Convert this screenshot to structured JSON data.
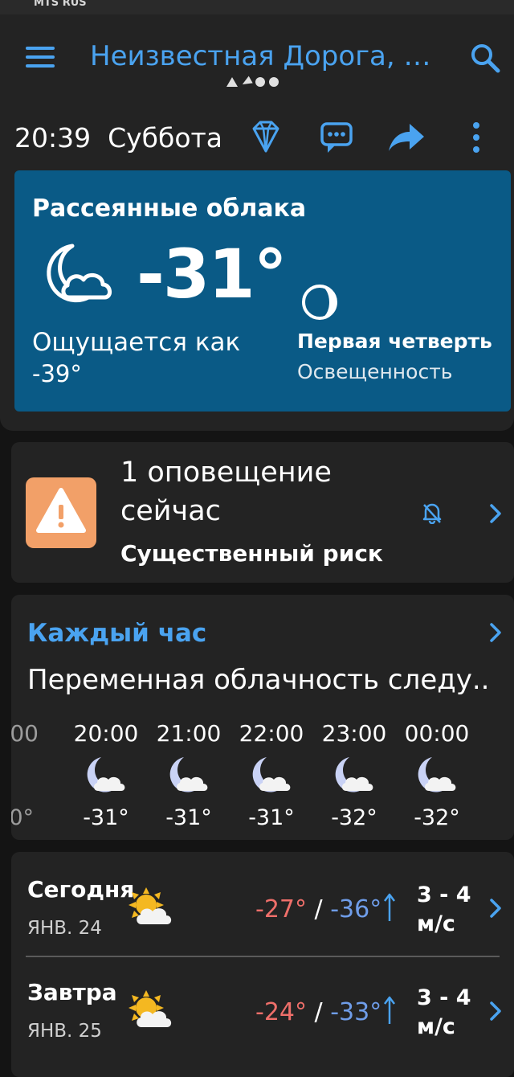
{
  "status_bar": {
    "carrier": "MTS RUS"
  },
  "app_bar": {
    "location_title": "Неизвестная Дорога, Т..."
  },
  "toolbar": {
    "time": "20:39",
    "day": "Суббота"
  },
  "current": {
    "condition": "Рассеянные облака",
    "temperature": "-31°",
    "feels_like_label": "Ощущается как",
    "feels_like_value": "-39°",
    "moon_phase": "Первая четверть",
    "moon_subtitle": "Освещенность"
  },
  "alert": {
    "line1": "1 оповещение",
    "line2": "сейчас",
    "risk": "Существенный риск",
    "color": "#f2a068"
  },
  "hourly": {
    "title": "Каждый час",
    "summary": "Переменная облачность следу..",
    "partial_time": "00",
    "partial_temp": "0°",
    "hours": [
      {
        "time": "20:00",
        "temp": "-31°",
        "icon": "night-cloudy-icon"
      },
      {
        "time": "21:00",
        "temp": "-31°",
        "icon": "night-cloudy-icon"
      },
      {
        "time": "22:00",
        "temp": "-31°",
        "icon": "night-cloudy-icon"
      },
      {
        "time": "23:00",
        "temp": "-32°",
        "icon": "night-cloudy-icon"
      },
      {
        "time": "00:00",
        "temp": "-32°",
        "icon": "night-cloudy-icon"
      }
    ]
  },
  "daily": [
    {
      "name": "Сегодня",
      "date": "ЯНВ. 24",
      "high": "-27°",
      "low": "-36°",
      "sep": "/",
      "wind_top": "3 - 4",
      "wind_unit": "м/с",
      "icon": "sun-cloud-icon"
    },
    {
      "name": "Завтра",
      "date": "ЯНВ. 25",
      "high": "-24°",
      "low": "-33°",
      "sep": "/",
      "wind_top": "3 - 4",
      "wind_unit": "м/с",
      "icon": "sun-cloud-icon"
    }
  ],
  "colors": {
    "accent": "#4aa3f0",
    "card_bg": "#232323",
    "current_bg": "#0a5a86",
    "high": "#ef6f6a",
    "low": "#6f9de9"
  }
}
